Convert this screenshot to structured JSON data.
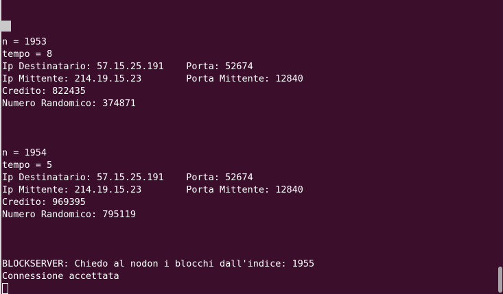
{
  "terminal": {
    "lines": [
      "n = 1953",
      "tempo = 8",
      "Ip Destinatario: 57.15.25.191    Porta: 52674",
      "Ip Mittente: 214.19.15.23        Porta Mittente: 12840",
      "Credito: 822435",
      "Numero Randomico: 374871",
      "",
      "",
      "",
      "n = 1954",
      "tempo = 5",
      "Ip Destinatario: 57.15.25.191    Porta: 52674",
      "Ip Mittente: 214.19.15.23        Porta Mittente: 12840",
      "Credito: 969395",
      "Numero Randomico: 795119",
      "",
      "",
      "",
      "BLOCKSERVER: Chiedo al nodon i blocchi dall'indice: 1955",
      "Connessione accettata"
    ]
  },
  "colors": {
    "background": "#3b0f2c",
    "text": "#ffffff",
    "scroll_thumb": "#a9a2a6"
  }
}
